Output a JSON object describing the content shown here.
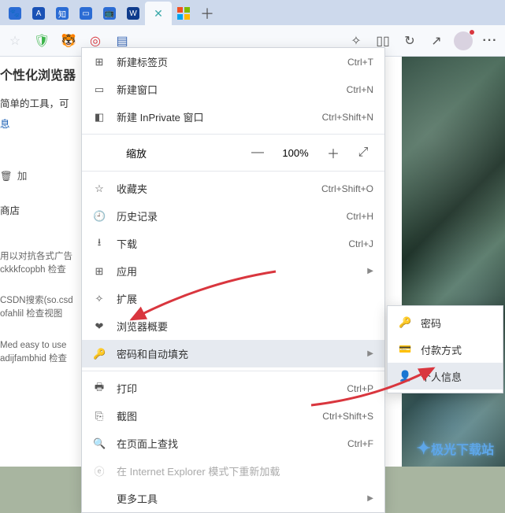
{
  "tabs": {
    "add_glyph": "＋"
  },
  "toolbar": {
    "more_glyph": "···"
  },
  "page": {
    "title": "个性化浏览器",
    "line1_a": "简单的工具，可",
    "line1_b": "息",
    "addfav_icon": "🗑",
    "addfav_label": "加",
    "store": "商店",
    "block1a": "用以对抗各式广告",
    "block1b": "ckkkfcopbh 检查",
    "block2a": "CSDN搜索(so.csd",
    "block2b": "ofahlil 检查视图",
    "block3a": "Med easy to use",
    "block3b": "adijfambhid 检查"
  },
  "menu": {
    "new_tab": {
      "label": "新建标签页",
      "shortcut": "Ctrl+T"
    },
    "new_window": {
      "label": "新建窗口",
      "shortcut": "Ctrl+N"
    },
    "new_inprivate": {
      "label": "新建 InPrivate 窗口",
      "shortcut": "Ctrl+Shift+N"
    },
    "zoom": {
      "label": "缩放",
      "minus": "—",
      "pct": "100%",
      "plus": "＋",
      "full": "⤢"
    },
    "favorites": {
      "label": "收藏夹",
      "shortcut": "Ctrl+Shift+O"
    },
    "history": {
      "label": "历史记录",
      "shortcut": "Ctrl+H"
    },
    "downloads": {
      "label": "下载",
      "shortcut": "Ctrl+J"
    },
    "apps": {
      "label": "应用"
    },
    "extensions": {
      "label": "扩展"
    },
    "browser_essentials": {
      "label": "浏览器概要"
    },
    "passwords_autofill": {
      "label": "密码和自动填充"
    },
    "print": {
      "label": "打印",
      "shortcut": "Ctrl+P"
    },
    "screenshot": {
      "label": "截图",
      "shortcut": "Ctrl+Shift+S"
    },
    "find": {
      "label": "在页面上查找",
      "shortcut": "Ctrl+F"
    },
    "ie_mode": {
      "label": "在 Internet Explorer 模式下重新加载"
    },
    "more_tools": {
      "label": "更多工具"
    }
  },
  "submenu": {
    "passwords": "密码",
    "payment": "付款方式",
    "personal": "个人信息"
  },
  "watermark": "极光下载站"
}
